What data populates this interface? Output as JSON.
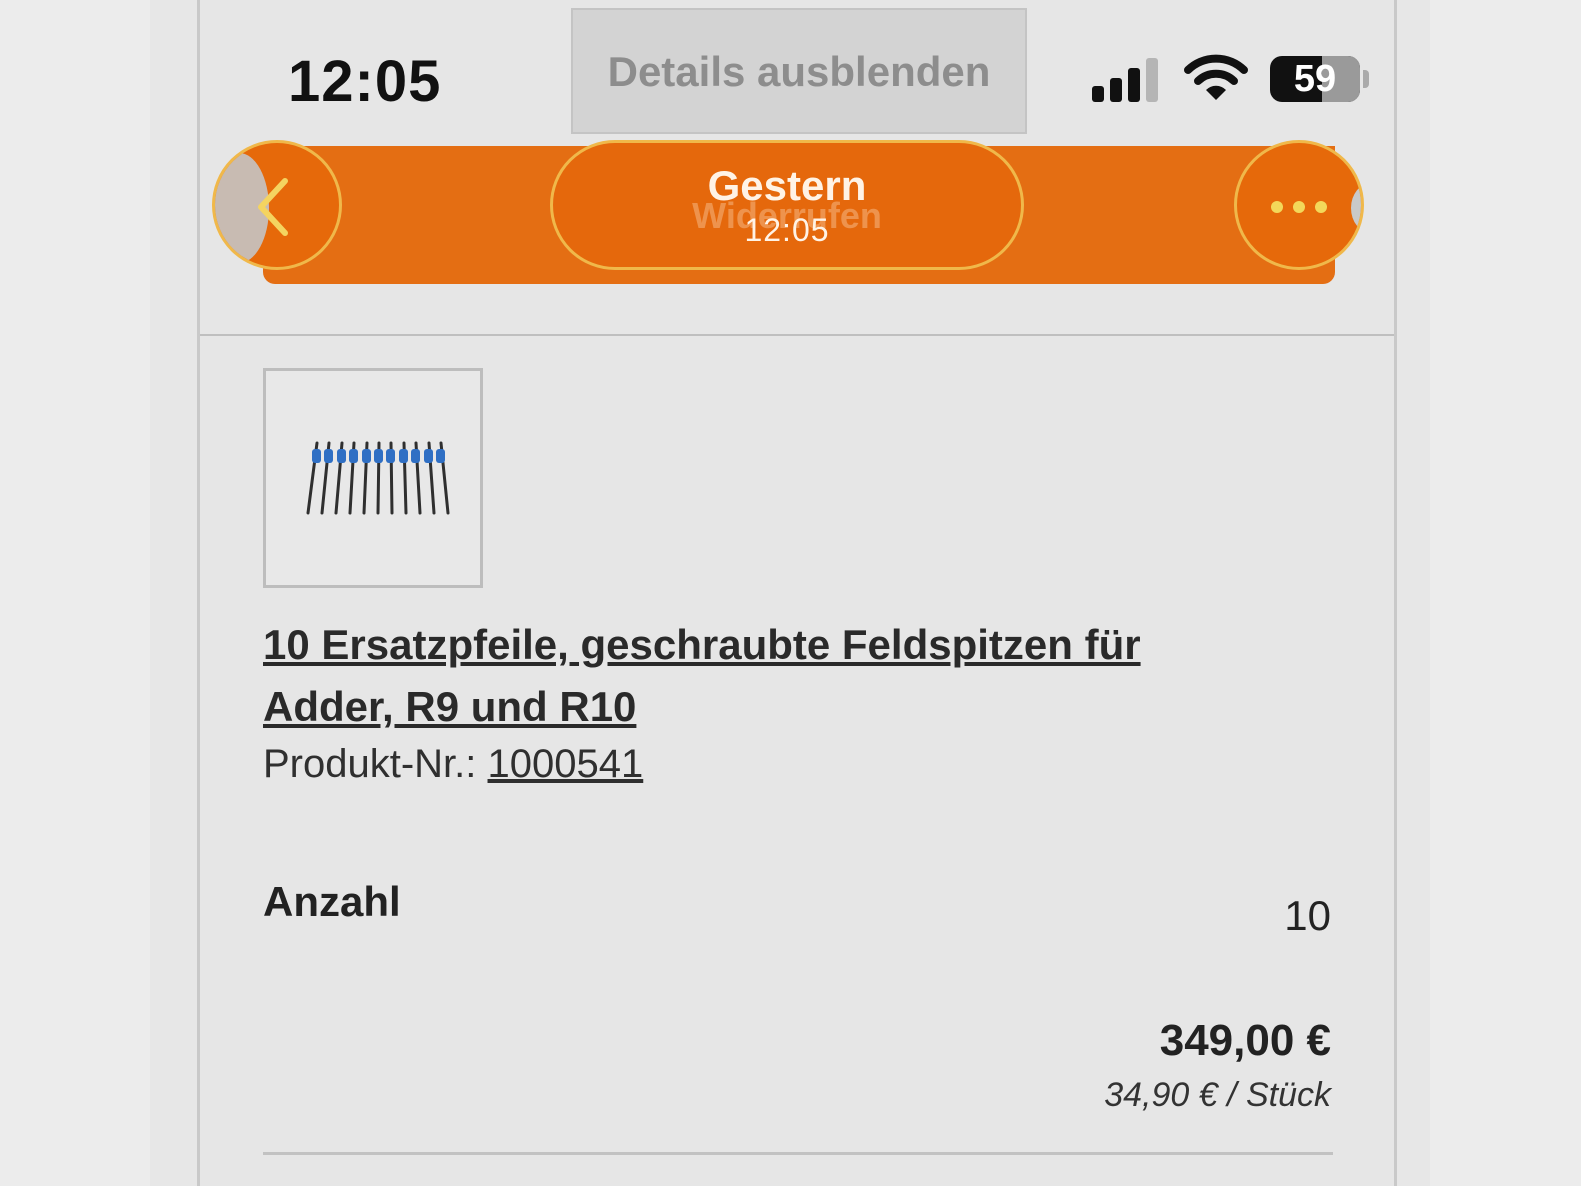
{
  "status_bar": {
    "time": "12:05",
    "battery": "59"
  },
  "header": {
    "details_toggle_label": "Details ausblenden",
    "date_day": "Gestern",
    "date_time": "12:05",
    "ghost_text": "Widerrufen"
  },
  "product": {
    "title": "10 Ersatzpfeile, geschraubte Feldspitzen für Adder, R9 und R10",
    "nr_label": "Produkt-Nr.: ",
    "nr_value": "1000541",
    "image_icon": "arrows-product-image"
  },
  "order": {
    "qty_label": "Anzahl",
    "qty_value": "10",
    "price": "349,00 €",
    "unit_price": "34,90 € / Stück"
  },
  "colors": {
    "accent": "#e46e13",
    "border_accent": "#f0b84a",
    "background": "#e6e6e6"
  }
}
